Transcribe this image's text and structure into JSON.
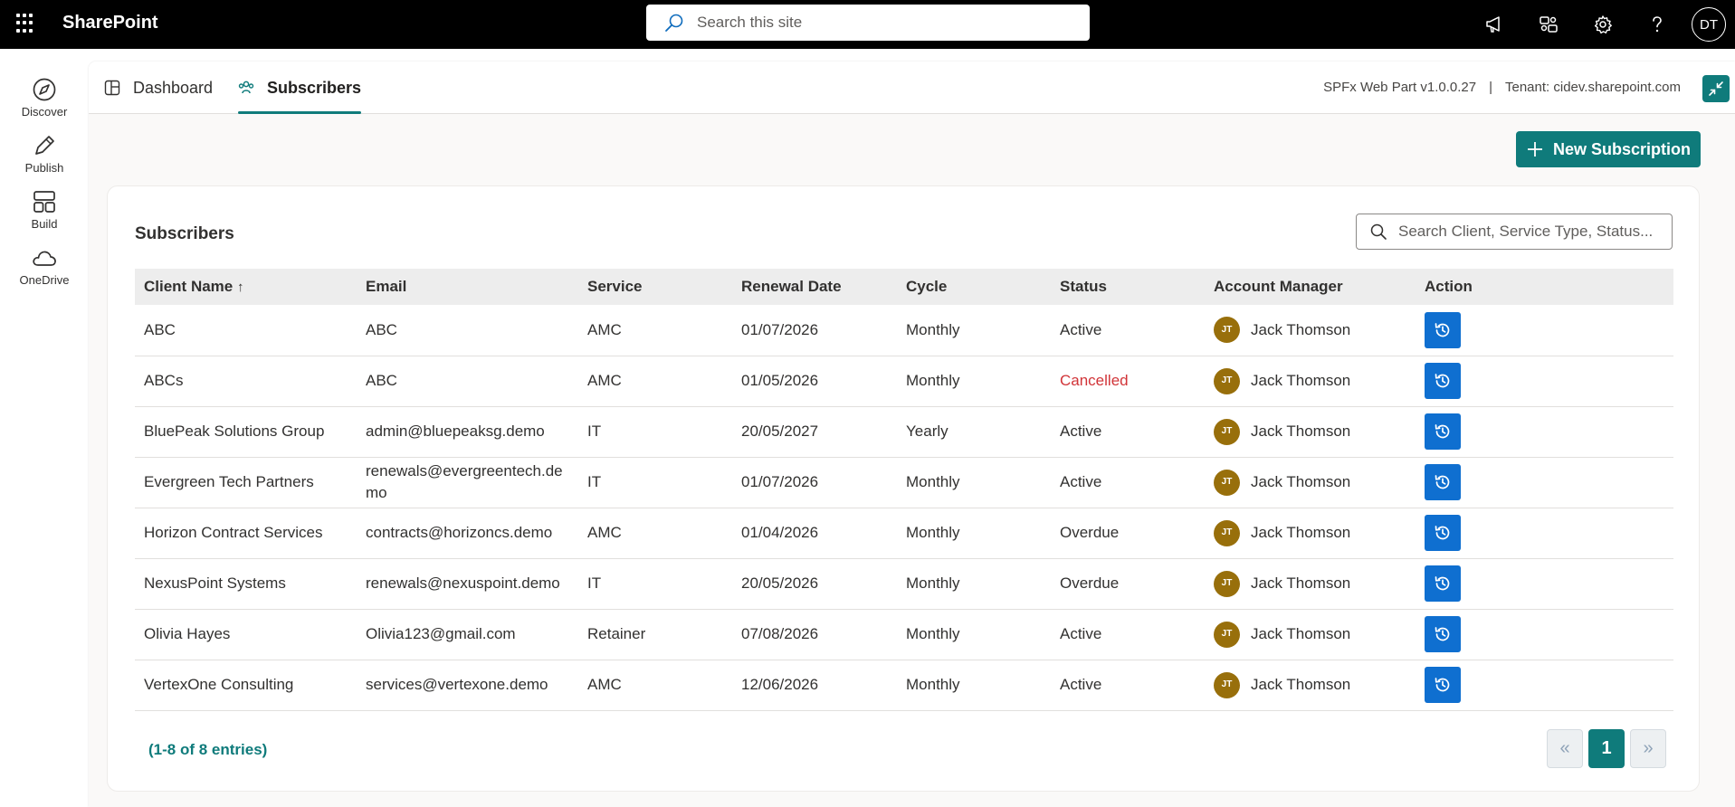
{
  "app": {
    "title": "SharePoint"
  },
  "top_search": {
    "placeholder": "Search this site"
  },
  "user": {
    "initials": "DT"
  },
  "appbar": [
    {
      "label": "Discover",
      "icon": "compass-icon"
    },
    {
      "label": "Publish",
      "icon": "pen-icon"
    },
    {
      "label": "Build",
      "icon": "layout-icon"
    },
    {
      "label": "OneDrive",
      "icon": "cloud-icon"
    }
  ],
  "tabs": [
    {
      "label": "Dashboard",
      "icon": "dashboard-icon",
      "active": false
    },
    {
      "label": "Subscribers",
      "icon": "people-icon",
      "active": true
    }
  ],
  "meta": {
    "version": "SPFx Web Part v1.0.0.27",
    "separator": "|",
    "tenant": "Tenant: cidev.sharepoint.com"
  },
  "new_subscription_label": "New Subscription",
  "card": {
    "title": "Subscribers",
    "search_placeholder": "Search Client, Service Type, Status..."
  },
  "table": {
    "columns": [
      "Client Name",
      "Email",
      "Service",
      "Renewal Date",
      "Cycle",
      "Status",
      "Account Manager",
      "Action"
    ],
    "sort_indicator": "↑",
    "rows": [
      {
        "client": "ABC",
        "email": "ABC",
        "service": "AMC",
        "renewal": "01/07/2026",
        "cycle": "Monthly",
        "status": "Active",
        "manager": "Jack Thomson",
        "manager_initials": "JT"
      },
      {
        "client": "ABCs",
        "email": "ABC",
        "service": "AMC",
        "renewal": "01/05/2026",
        "cycle": "Monthly",
        "status": "Cancelled",
        "manager": "Jack Thomson",
        "manager_initials": "JT"
      },
      {
        "client": "BluePeak Solutions Group",
        "email": "admin@bluepeaksg.demo",
        "service": "IT",
        "renewal": "20/05/2027",
        "cycle": "Yearly",
        "status": "Active",
        "manager": "Jack Thomson",
        "manager_initials": "JT"
      },
      {
        "client": "Evergreen Tech Partners",
        "email": "renewals@evergreentech.demo",
        "service": "IT",
        "renewal": "01/07/2026",
        "cycle": "Monthly",
        "status": "Active",
        "manager": "Jack Thomson",
        "manager_initials": "JT"
      },
      {
        "client": "Horizon Contract Services",
        "email": "contracts@horizoncs.demo",
        "service": "AMC",
        "renewal": "01/04/2026",
        "cycle": "Monthly",
        "status": "Overdue",
        "manager": "Jack Thomson",
        "manager_initials": "JT"
      },
      {
        "client": "NexusPoint Systems",
        "email": "renewals@nexuspoint.demo",
        "service": "IT",
        "renewal": "20/05/2026",
        "cycle": "Monthly",
        "status": "Overdue",
        "manager": "Jack Thomson",
        "manager_initials": "JT"
      },
      {
        "client": "Olivia Hayes",
        "email": "Olivia123@gmail.com",
        "service": "Retainer",
        "renewal": "07/08/2026",
        "cycle": "Monthly",
        "status": "Active",
        "manager": "Jack Thomson",
        "manager_initials": "JT"
      },
      {
        "client": "VertexOne Consulting",
        "email": "services@vertexone.demo",
        "service": "AMC",
        "renewal": "12/06/2026",
        "cycle": "Monthly",
        "status": "Active",
        "manager": "Jack Thomson",
        "manager_initials": "JT"
      }
    ]
  },
  "pagination": {
    "summary": "(1-8 of 8 entries)",
    "current_page": "1",
    "prev": "«",
    "next": "»"
  },
  "colors": {
    "accent": "#0f7b7b",
    "action_button": "#0f6fd0",
    "avatar": "#986f0b",
    "cancelled": "#d13438"
  }
}
